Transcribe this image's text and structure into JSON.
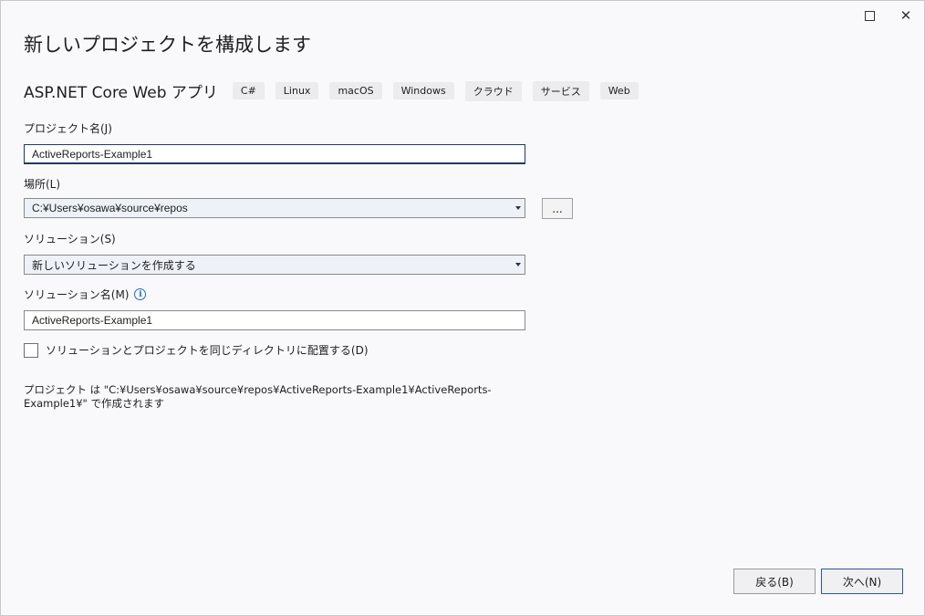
{
  "dialog": {
    "title": "新しいプロジェクトを構成します",
    "template_name": "ASP.NET Core Web アプリ",
    "tags": [
      "C#",
      "Linux",
      "macOS",
      "Windows",
      "クラウド",
      "サービス",
      "Web"
    ]
  },
  "project_name": {
    "label": "プロジェクト名(J)",
    "value": "ActiveReports-Example1"
  },
  "location": {
    "label": "場所(L)",
    "value": "C:¥Users¥osawa¥source¥repos",
    "browse_label": "..."
  },
  "solution": {
    "label": "ソリューション(S)",
    "value": "新しいソリューションを作成する"
  },
  "solution_name": {
    "label": "ソリューション名(M)",
    "info_glyph": "i",
    "value": "ActiveReports-Example1"
  },
  "same_dir": {
    "label": "ソリューションとプロジェクトを同じディレクトリに配置する(D)",
    "checked": false
  },
  "summary_text": "プロジェクト は \"C:¥Users¥osawa¥source¥repos¥ActiveReports-Example1¥ActiveReports-Example1¥\" で作成されます",
  "buttons": {
    "back": "戻る(B)",
    "next": "次へ(N)"
  },
  "window_controls": {
    "close_glyph": "✕"
  },
  "colors": {
    "accent": "#1b6ac6",
    "focus_border": "#1e3a5f"
  }
}
